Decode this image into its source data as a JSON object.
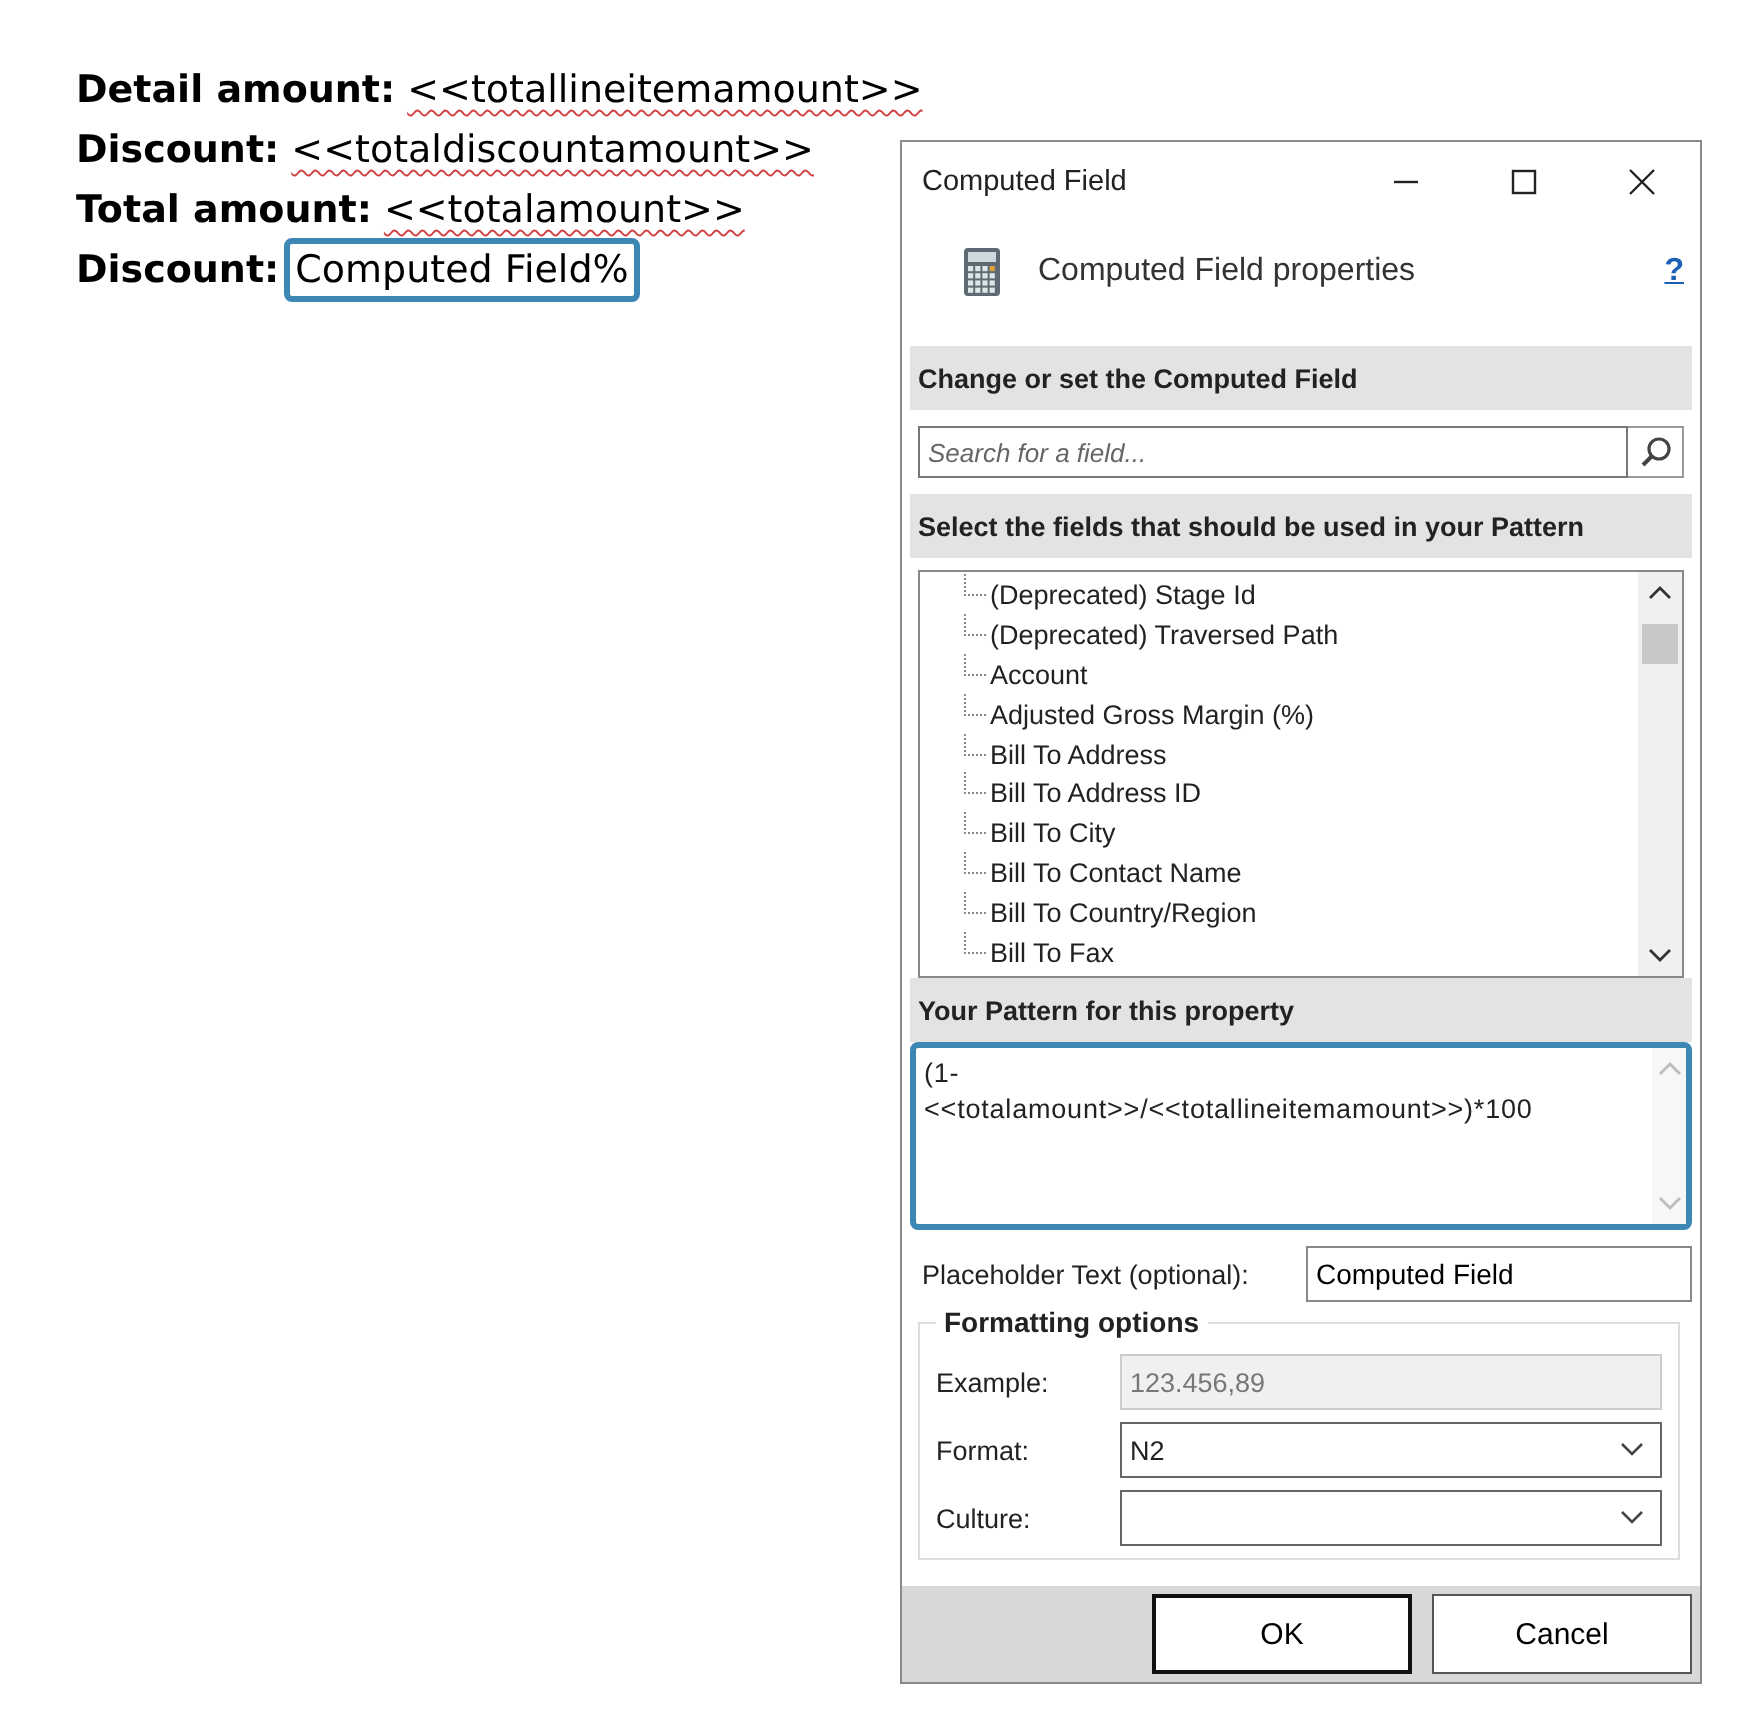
{
  "document": {
    "lines": [
      {
        "label": "Detail amount:",
        "value": "<<totallineitemamount>>",
        "kind": "merge"
      },
      {
        "label": "Discount:",
        "value": "<<totaldiscountamount>>",
        "kind": "merge"
      },
      {
        "label": "Total amount:",
        "value": "<<totalamount>>",
        "kind": "merge"
      },
      {
        "label": "Discount:",
        "value": "Computed Field%",
        "kind": "field"
      }
    ]
  },
  "dialog": {
    "title": "Computed Field",
    "header": "Computed Field properties",
    "help": "?",
    "section_change": "Change or set the Computed Field",
    "search": {
      "placeholder": "Search for a field..."
    },
    "section_fields": "Select the fields that should be used in your Pattern",
    "fields": [
      "(Deprecated) Stage Id",
      "(Deprecated) Traversed Path",
      "Account",
      "Adjusted Gross Margin (%)",
      "Bill To Address",
      "Bill To Address ID",
      "Bill To City",
      "Bill To Contact Name",
      "Bill To Country/Region",
      "Bill To Fax"
    ],
    "section_pattern": "Your Pattern for this property",
    "pattern": "(1-<<totalamount>>/<<totallineitemamount>>)*100",
    "placeholder_label": "Placeholder Text (optional):",
    "placeholder_field": {
      "value": "Computed Field"
    },
    "formatting": {
      "legend": "Formatting options",
      "rows": [
        {
          "label": "Example:",
          "value": "123.456,89",
          "kind": "readonly",
          "disabled": true
        },
        {
          "label": "Format:",
          "value": "N2",
          "kind": "dropdown"
        },
        {
          "label": "Culture:",
          "kind": "dropdown"
        }
      ]
    },
    "buttons": [
      {
        "label": "OK",
        "default": true
      },
      {
        "label": "Cancel",
        "default": false
      }
    ]
  }
}
